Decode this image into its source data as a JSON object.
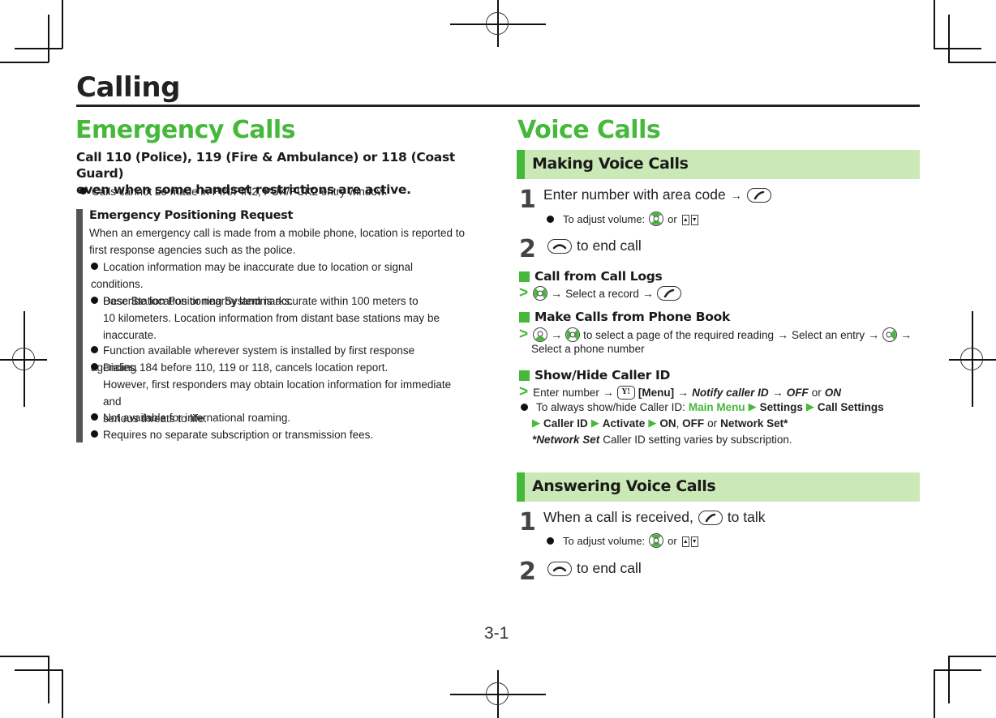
{
  "chapter": {
    "title": "Calling",
    "page_number": "3-1"
  },
  "emergency": {
    "title": "Emergency Calls",
    "lead": [
      "Call 110 (Police), 119 (Fire & Ambulance) or 118 (Coast Guard)",
      "even when some handset restrictions are active."
    ],
    "bullet": "Calls cannot be made in PIN/PIN2, PUK/PUK2 entry window.",
    "note": {
      "title": "Emergency Positioning Request",
      "intro": [
        "When an emergency call is made from a mobile phone, location is reported to",
        "first response agencies such as the police."
      ],
      "bullets": [
        [
          "Location information may be inaccurate due to location or signal conditions.",
          "Describe location or nearby landmarks."
        ],
        [
          "Base Station Positioning System is accurate within 100 meters to",
          "10 kilometers. Location information from distant base stations may be",
          "inaccurate."
        ],
        [
          "Function available wherever system is installed by first response agencies."
        ],
        [
          "Dialing 184 before 110, 119 or 118, cancels location report.",
          "However, first responders may obtain location information for immediate and",
          "serious threats to life."
        ],
        [
          "Not available for international roaming."
        ],
        [
          "Requires no separate subscription or transmission fees."
        ]
      ]
    }
  },
  "voice": {
    "title": "Voice Calls",
    "making": {
      "banner": "Making Voice Calls",
      "step1": {
        "num": "1",
        "text": "Enter number with area code",
        "arrow": "→",
        "sub": "To adjust volume:",
        "or": "or"
      },
      "step2": {
        "num": "2",
        "text": "to end call"
      },
      "call_logs": {
        "title": "Call from Call Logs",
        "arrow": "→",
        "text": "Select a record"
      },
      "phone_book": {
        "title": "Make Calls from Phone Book",
        "text1": "to select a page of the required reading",
        "text2": "Select an entry",
        "text3": "Select a phone number"
      },
      "caller_id": {
        "title": "Show/Hide Caller ID",
        "proc_text": "Enter number",
        "menu": "[Menu]",
        "notify": "Notify caller ID",
        "off": "OFF",
        "or": "or",
        "on": "ON",
        "bullet_intro": "To always show/hide Caller ID:",
        "path": [
          "Main Menu",
          "Settings",
          "Call Settings",
          "Caller ID",
          "Activate"
        ],
        "options": {
          "on": "ON",
          "off": "OFF",
          "or": "or",
          "network": "Network Set*"
        },
        "footnote_bold": "*Network Set",
        "footnote": "Caller ID setting varies by subscription."
      }
    },
    "answering": {
      "banner": "Answering Voice Calls",
      "step1": {
        "num": "1",
        "text_before": "When a call is received,",
        "text_after": "to talk",
        "sub": "To adjust volume:",
        "or": "or"
      },
      "step2": {
        "num": "2",
        "text": "to end call"
      }
    }
  },
  "icons": {
    "arrow_up": "▲",
    "arrow_down": "▼",
    "yahoo_key": "Y!",
    "triangle": "▶",
    "chevron": ">"
  },
  "colors": {
    "accent": "#46b83a",
    "banner_bg": "#cbe9b6",
    "note_bar": "#555555"
  }
}
